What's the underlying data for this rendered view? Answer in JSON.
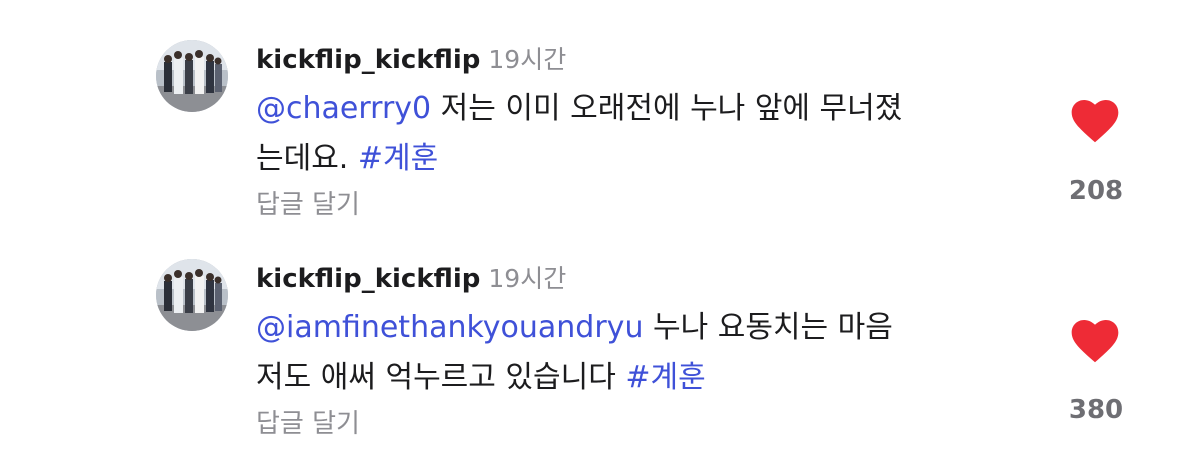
{
  "colors": {
    "link": "#3f51d8",
    "heart": "#ee2b36",
    "muted": "#8e8e93",
    "text": "#1c1c1e"
  },
  "comments": [
    {
      "username": "kickflip_kickflip",
      "time": "19시간",
      "mention": "@chaerrry0",
      "text_line1": " 저는 이미 오래전에 누나 앞에 무너졌",
      "text_line2": "는데요. ",
      "hashtag": "#계훈",
      "reply_label": "답글 달기",
      "like_icon": "heart-filled-icon",
      "like_count": "208"
    },
    {
      "username": "kickflip_kickflip",
      "time": "19시간",
      "mention": "@iamfinethankyouandryu",
      "text_line1": " 누나 요동치는 마음",
      "text_line2": "저도 애써 억누르고 있습니다 ",
      "hashtag": "#계훈",
      "reply_label": "답글 달기",
      "like_icon": "heart-filled-icon",
      "like_count": "380"
    }
  ]
}
